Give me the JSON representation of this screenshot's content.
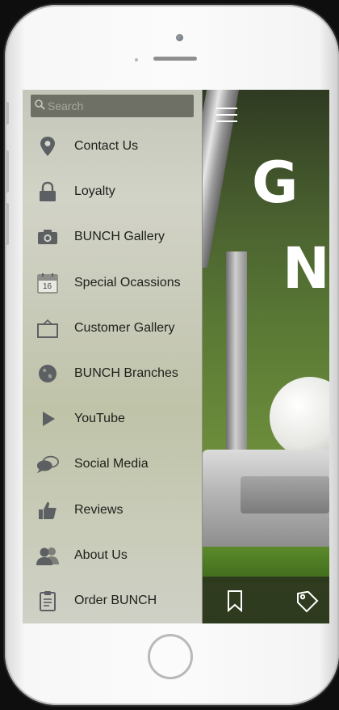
{
  "search": {
    "placeholder": "Search"
  },
  "menu": {
    "items": [
      {
        "label": "Contact Us",
        "icon": "location-pin-icon"
      },
      {
        "label": "Loyalty",
        "icon": "lock-icon"
      },
      {
        "label": "BUNCH Gallery",
        "icon": "camera-icon"
      },
      {
        "label": "Special Ocassions",
        "icon": "calendar-icon",
        "calendar_day": "16"
      },
      {
        "label": "Customer Gallery",
        "icon": "picture-frame-icon"
      },
      {
        "label": "BUNCH Branches",
        "icon": "globe-icon"
      },
      {
        "label": "YouTube",
        "icon": "play-icon"
      },
      {
        "label": "Social Media",
        "icon": "chat-bubbles-icon"
      },
      {
        "label": "Reviews",
        "icon": "thumbs-up-icon"
      },
      {
        "label": "About Us",
        "icon": "people-icon"
      },
      {
        "label": "Order BUNCH",
        "icon": "clipboard-icon"
      }
    ]
  },
  "hero": {
    "line1": "G",
    "line2": "N"
  },
  "bottom_bar": {
    "icons": [
      "bookmark-icon",
      "tag-icon"
    ]
  },
  "colors": {
    "drawer_bg": "#c9cbba",
    "search_bg": "#6e7066",
    "icon_gray": "#5d6062",
    "text": "#1e1f1b"
  }
}
